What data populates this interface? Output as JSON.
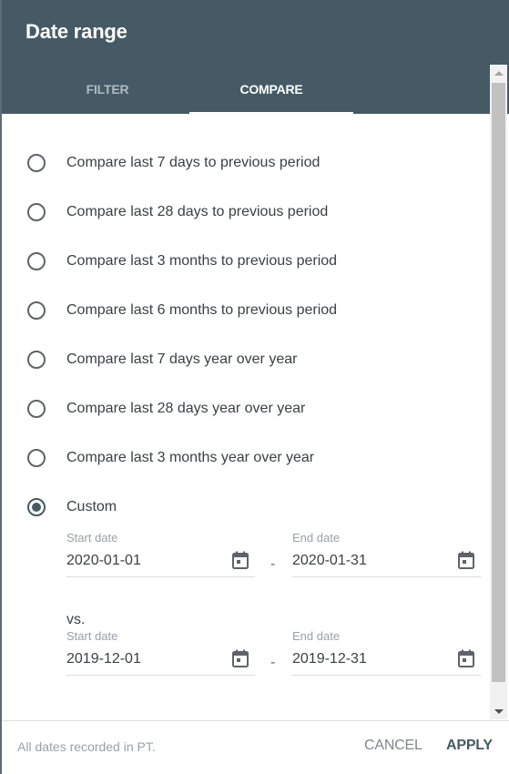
{
  "dialog": {
    "title": "Date range"
  },
  "tabs": [
    {
      "label": "FILTER",
      "active": false
    },
    {
      "label": "COMPARE",
      "active": true
    }
  ],
  "options": [
    {
      "label": "Compare last 7 days to previous period",
      "checked": false
    },
    {
      "label": "Compare last 28 days to previous period",
      "checked": false
    },
    {
      "label": "Compare last 3 months to previous period",
      "checked": false
    },
    {
      "label": "Compare last 6 months to previous period",
      "checked": false
    },
    {
      "label": "Compare last 7 days year over year",
      "checked": false
    },
    {
      "label": "Compare last 28 days year over year",
      "checked": false
    },
    {
      "label": "Compare last 3 months year over year",
      "checked": false
    },
    {
      "label": "Custom",
      "checked": true
    }
  ],
  "custom": {
    "range1": {
      "start_label": "Start date",
      "start_value": "2020-01-01",
      "end_label": "End date",
      "end_value": "2020-01-31"
    },
    "separator": "-",
    "vs_label": "vs.",
    "range2": {
      "start_label": "Start date",
      "start_value": "2019-12-01",
      "end_label": "End date",
      "end_value": "2019-12-31"
    }
  },
  "footer": {
    "note": "All dates recorded in PT.",
    "cancel_label": "CANCEL",
    "apply_label": "APPLY"
  },
  "colors": {
    "header_bg": "#455a64",
    "accent": "#455a64"
  },
  "icons": {
    "calendar": "calendar-icon",
    "radio": "radio-button"
  }
}
